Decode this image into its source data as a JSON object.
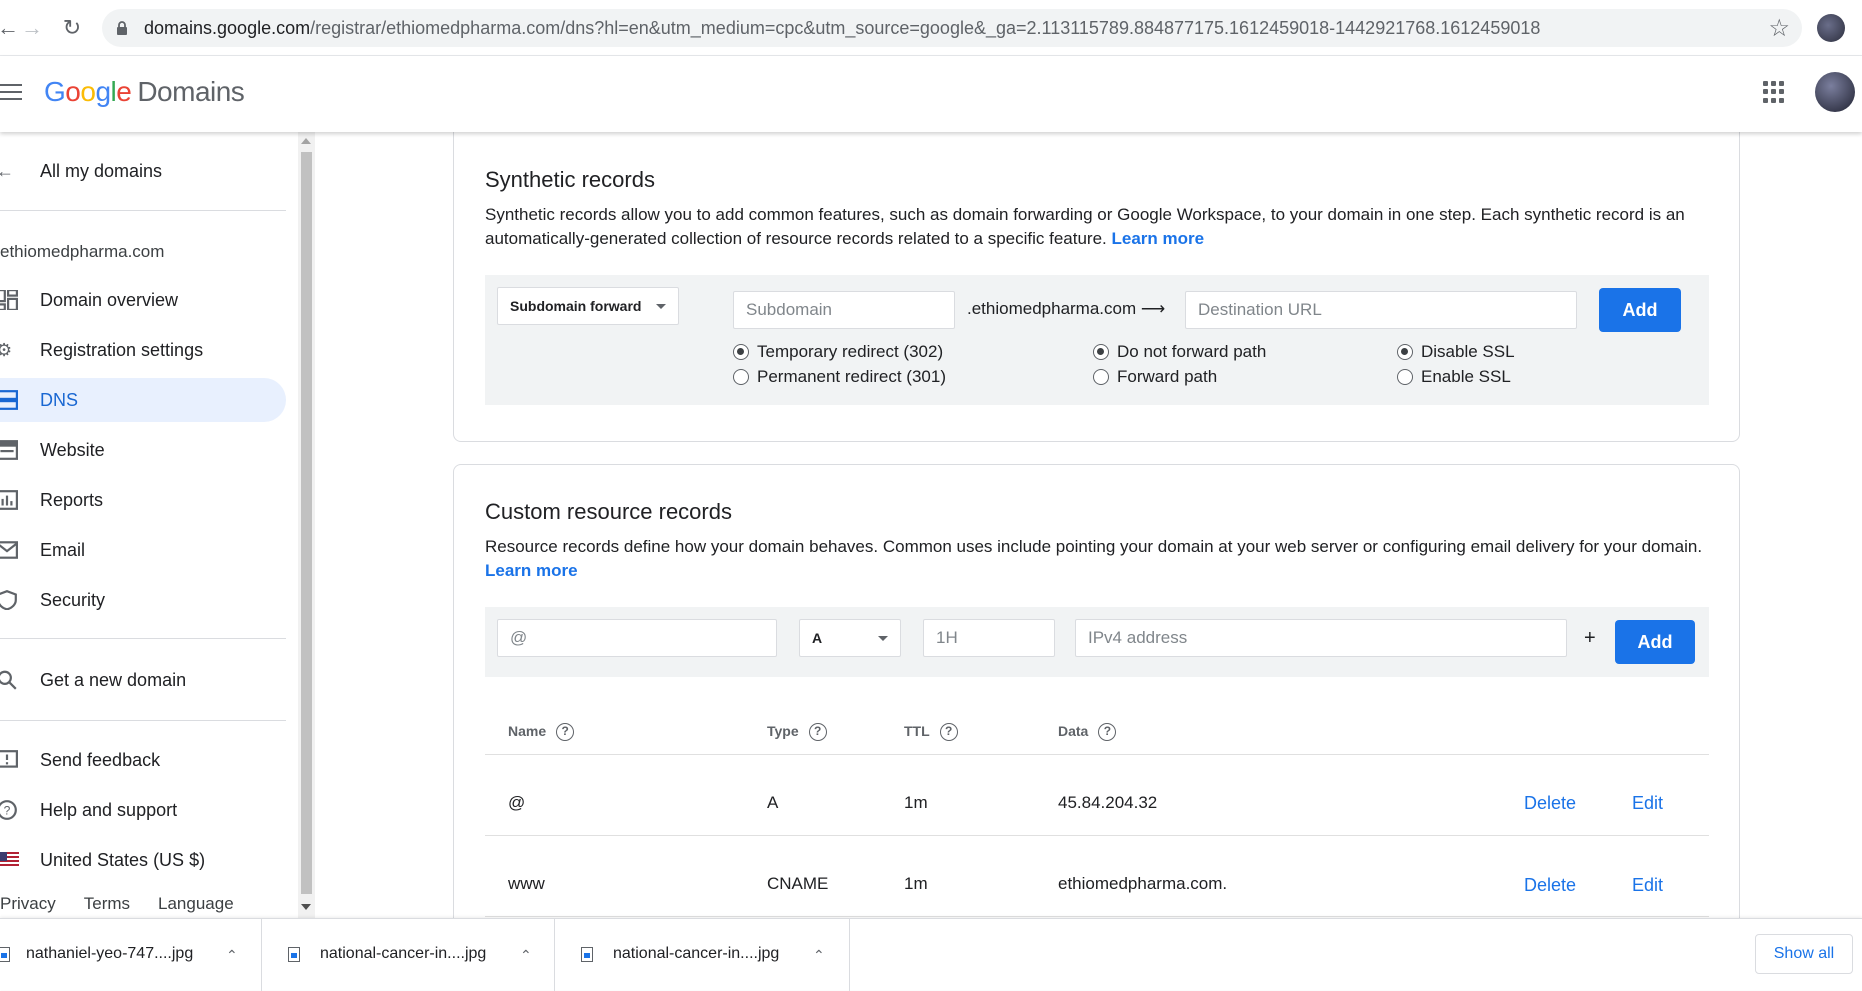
{
  "browser": {
    "url_host": "domains.google.com",
    "url_path": "/registrar/ethiomedpharma.com/dns?hl=en&utm_medium=cpc&utm_source=google&_ga=2.113115789.884877175.1612459018-1442921768.1612459018"
  },
  "header": {
    "logo_letters": [
      "G",
      "o",
      "o",
      "g",
      "l",
      "e"
    ],
    "logo_product": "Domains"
  },
  "sidebar": {
    "back_label": "All my domains",
    "domain": "ethiomedpharma.com",
    "items": [
      {
        "label": "Domain overview",
        "icon": "dashboard-icon"
      },
      {
        "label": "Registration settings",
        "icon": "gear-icon"
      },
      {
        "label": "DNS",
        "icon": "dns-icon",
        "active": true
      },
      {
        "label": "Website",
        "icon": "web-icon"
      },
      {
        "label": "Reports",
        "icon": "bar-chart-icon"
      },
      {
        "label": "Email",
        "icon": "mail-icon"
      },
      {
        "label": "Security",
        "icon": "shield-icon"
      }
    ],
    "get_domain": "Get a new domain",
    "secondary": [
      {
        "label": "Send feedback",
        "icon": "feedback-icon"
      },
      {
        "label": "Help and support",
        "icon": "help-icon"
      },
      {
        "label": "United States (US $)",
        "icon": "us-flag-icon"
      }
    ],
    "footer": [
      "Privacy",
      "Terms",
      "Language"
    ]
  },
  "synthetic": {
    "title": "Synthetic records",
    "desc": "Synthetic records allow you to add common features, such as domain forwarding or Google Workspace, to your domain in one step. Each synthetic record is an automatically-generated collection of resource records related to a specific feature.",
    "learn_more": "Learn more",
    "type_select": "Subdomain forward",
    "subdomain_placeholder": "Subdomain",
    "domain_suffix": ".ethiomedpharma.com ⟶",
    "destination_placeholder": "Destination URL",
    "add": "Add",
    "radios": {
      "temporary": "Temporary redirect (302)",
      "permanent": "Permanent redirect (301)",
      "no_forward_path": "Do not forward path",
      "forward_path": "Forward path",
      "disable_ssl": "Disable SSL",
      "enable_ssl": "Enable SSL"
    }
  },
  "custom": {
    "title": "Custom resource records",
    "desc": "Resource records define how your domain behaves. Common uses include pointing your domain at your web server or configuring email delivery for your domain.",
    "learn_more": "Learn more",
    "name_placeholder": "@",
    "type_select": "A",
    "ttl_placeholder": "1H",
    "data_placeholder": "IPv4 address",
    "plus": "+",
    "add": "Add",
    "columns": [
      "Name",
      "Type",
      "TTL",
      "Data"
    ],
    "rows": [
      {
        "name": "@",
        "type": "A",
        "ttl": "1m",
        "data": "45.84.204.32"
      },
      {
        "name": "www",
        "type": "CNAME",
        "ttl": "1m",
        "data": "ethiomedpharma.com."
      }
    ],
    "delete": "Delete",
    "edit": "Edit"
  },
  "downloads": {
    "files": [
      "nathaniel-yeo-747....jpg",
      "national-cancer-in....jpg",
      "national-cancer-in....jpg"
    ],
    "show_all": "Show all"
  }
}
